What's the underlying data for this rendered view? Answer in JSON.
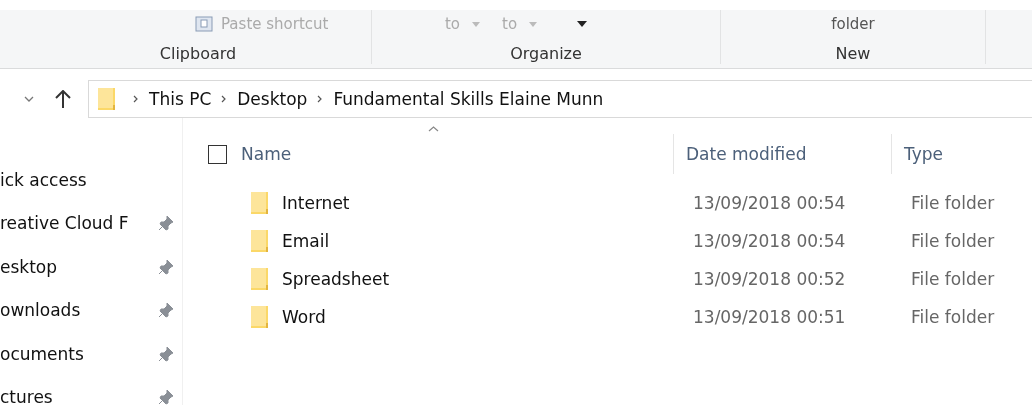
{
  "ribbon": {
    "groups": [
      {
        "label": "Clipboard",
        "items": [
          {
            "kind": "icon-button",
            "text": "Paste shortcut"
          }
        ]
      },
      {
        "label": "Organize",
        "items": [
          {
            "kind": "dropdown",
            "text": "to"
          },
          {
            "kind": "dropdown",
            "text": "to"
          },
          {
            "kind": "caret"
          }
        ]
      },
      {
        "label": "New",
        "items": [
          {
            "kind": "button",
            "text": "folder"
          }
        ]
      }
    ]
  },
  "address_bar": {
    "path": [
      "This PC",
      "Desktop",
      "Fundamental Skills Elaine Munn"
    ]
  },
  "sidebar": {
    "items": [
      {
        "label": "ick access",
        "pinned": false
      },
      {
        "label": "reative Cloud F",
        "pinned": true
      },
      {
        "label": "esktop",
        "pinned": true
      },
      {
        "label": "ownloads",
        "pinned": true
      },
      {
        "label": "ocuments",
        "pinned": true
      },
      {
        "label": "ctures",
        "pinned": true
      }
    ]
  },
  "table": {
    "select_all_checked": false,
    "columns": [
      {
        "label": "Name",
        "sorted": true
      },
      {
        "label": "Date modified",
        "sorted": false
      },
      {
        "label": "Type",
        "sorted": false
      }
    ],
    "rows": [
      {
        "name": "Internet",
        "date": "13/09/2018 00:54",
        "type": "File folder"
      },
      {
        "name": "Email",
        "date": "13/09/2018 00:54",
        "type": "File folder"
      },
      {
        "name": "Spreadsheet",
        "date": "13/09/2018 00:52",
        "type": "File folder"
      },
      {
        "name": "Word",
        "date": "13/09/2018 00:51",
        "type": "File folder"
      }
    ]
  }
}
